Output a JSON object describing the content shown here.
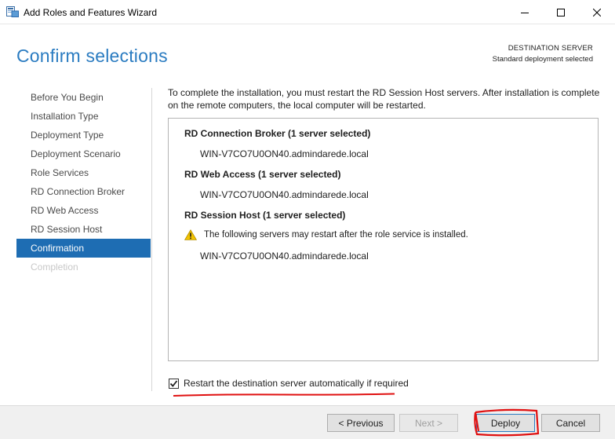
{
  "window": {
    "title": "Add Roles and Features Wizard"
  },
  "header": {
    "title": "Confirm selections",
    "destination_label": "DESTINATION SERVER",
    "destination_value": "Standard deployment selected"
  },
  "nav": {
    "items": [
      {
        "label": "Before You Begin",
        "state": "normal"
      },
      {
        "label": "Installation Type",
        "state": "normal"
      },
      {
        "label": "Deployment Type",
        "state": "normal"
      },
      {
        "label": "Deployment Scenario",
        "state": "normal"
      },
      {
        "label": "Role Services",
        "state": "normal"
      },
      {
        "label": "RD Connection Broker",
        "state": "normal"
      },
      {
        "label": "RD Web Access",
        "state": "normal"
      },
      {
        "label": "RD Session Host",
        "state": "normal"
      },
      {
        "label": "Confirmation",
        "state": "active"
      },
      {
        "label": "Completion",
        "state": "disabled"
      }
    ]
  },
  "main": {
    "intro": "To complete the installation, you must restart the RD Session Host servers. After installation is complete on the remote computers, the local computer will be restarted.",
    "roles": [
      {
        "title": "RD Connection Broker  (1 server selected)",
        "server": "WIN-V7CO7U0ON40.admindarede.local"
      },
      {
        "title": "RD Web Access  (1 server selected)",
        "server": "WIN-V7CO7U0ON40.admindarede.local"
      },
      {
        "title": "RD Session Host  (1 server selected)",
        "warning": "The following servers may restart after the role service is installed.",
        "server": "WIN-V7CO7U0ON40.admindarede.local"
      }
    ],
    "restart_checkbox": {
      "label": "Restart the destination server automatically if required",
      "checked": true
    }
  },
  "footer": {
    "previous_label": "< Previous",
    "next_label": "Next >",
    "deploy_label": "Deploy",
    "cancel_label": "Cancel"
  },
  "colors": {
    "accent": "#2b7cc1",
    "nav_active": "#1e6db3",
    "annotation_red": "#e01010",
    "warning_yellow": "#f2c300"
  }
}
